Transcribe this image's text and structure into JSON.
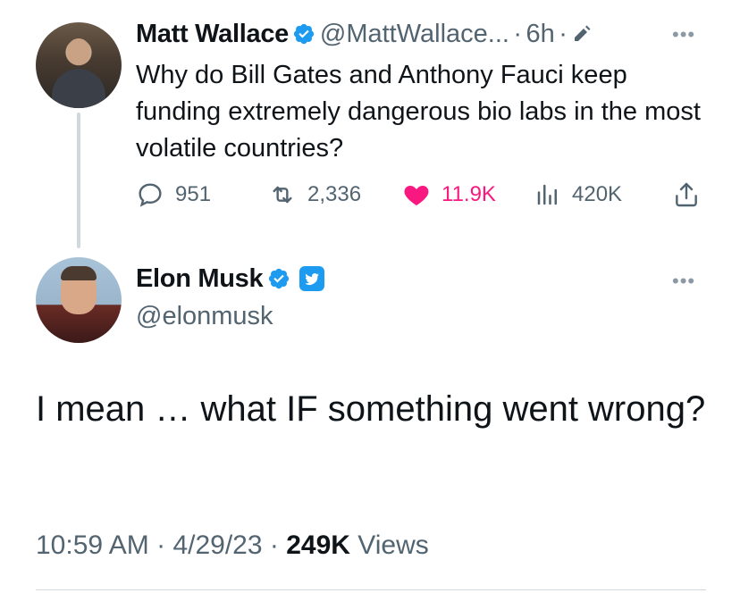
{
  "parent_tweet": {
    "author_name": "Matt Wallace",
    "author_handle": "@MattWallace...",
    "separator": "·",
    "time": "6h",
    "text": "Why do Bill Gates and Anthony Fauci keep funding extremely dangerous bio labs in the most volatile countries?",
    "more_icon": "more-icon",
    "actions": {
      "replies": "951",
      "retweets": "2,336",
      "likes": "11.9K",
      "views": "420K"
    }
  },
  "main_tweet": {
    "author_name": "Elon Musk",
    "author_handle": "@elonmusk",
    "text": "I mean … what IF something went wrong?",
    "time": "10:59 AM",
    "date": "4/29/23",
    "separator": "·",
    "views_count": "249K",
    "views_label": "Views"
  },
  "colors": {
    "verified": "#1d9bf0",
    "like": "#f91880",
    "muted": "#536471",
    "text": "#0f1419",
    "thread_line": "#cfd9de"
  }
}
